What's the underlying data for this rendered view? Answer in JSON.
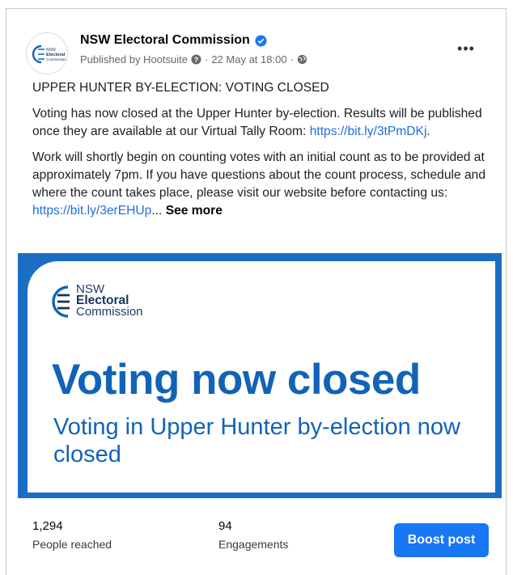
{
  "post": {
    "author": "NSW Electoral Commission",
    "published_by": "Published by Hootsuite",
    "date": "22 May at 18:00",
    "more_label": "•••",
    "title_line": "UPPER HUNTER BY-ELECTION: VOTING CLOSED",
    "para1": "Voting has now closed at the Upper Hunter by-election. Results will be published once they are available at our Virtual Tally Room: ",
    "link1": "https://bit.ly/3tPmDKj",
    "para1_end": ".",
    "para2": "Work will shortly begin on counting votes with an initial count as to be provided at approximately 7pm. If you have questions about the count process, schedule and where the count takes place, please visit our website before contacting us: ",
    "link2": "https://bit.ly/3erEHUp",
    "ellipsis": "...",
    "see_more": "See more"
  },
  "banner": {
    "logo_line1": "NSW",
    "logo_line2": "Electoral",
    "logo_line3": "Commission",
    "headline": "Voting now closed",
    "subline": "Voting in Upper Hunter by-election now closed"
  },
  "avatar": {
    "line1": "NSW",
    "line2": "Electoral",
    "line3": "Commission"
  },
  "stats": {
    "reached_value": "1,294",
    "reached_label": "People reached",
    "engagements_value": "94",
    "engagements_label": "Engagements",
    "boost_label": "Boost post"
  },
  "colors": {
    "brand_blue": "#1263b8",
    "link": "#216fdb",
    "button": "#1877f2"
  },
  "icons": [
    "verified-badge-icon",
    "help-icon",
    "globe-icon",
    "more-icon",
    "nsw-logo-icon"
  ]
}
